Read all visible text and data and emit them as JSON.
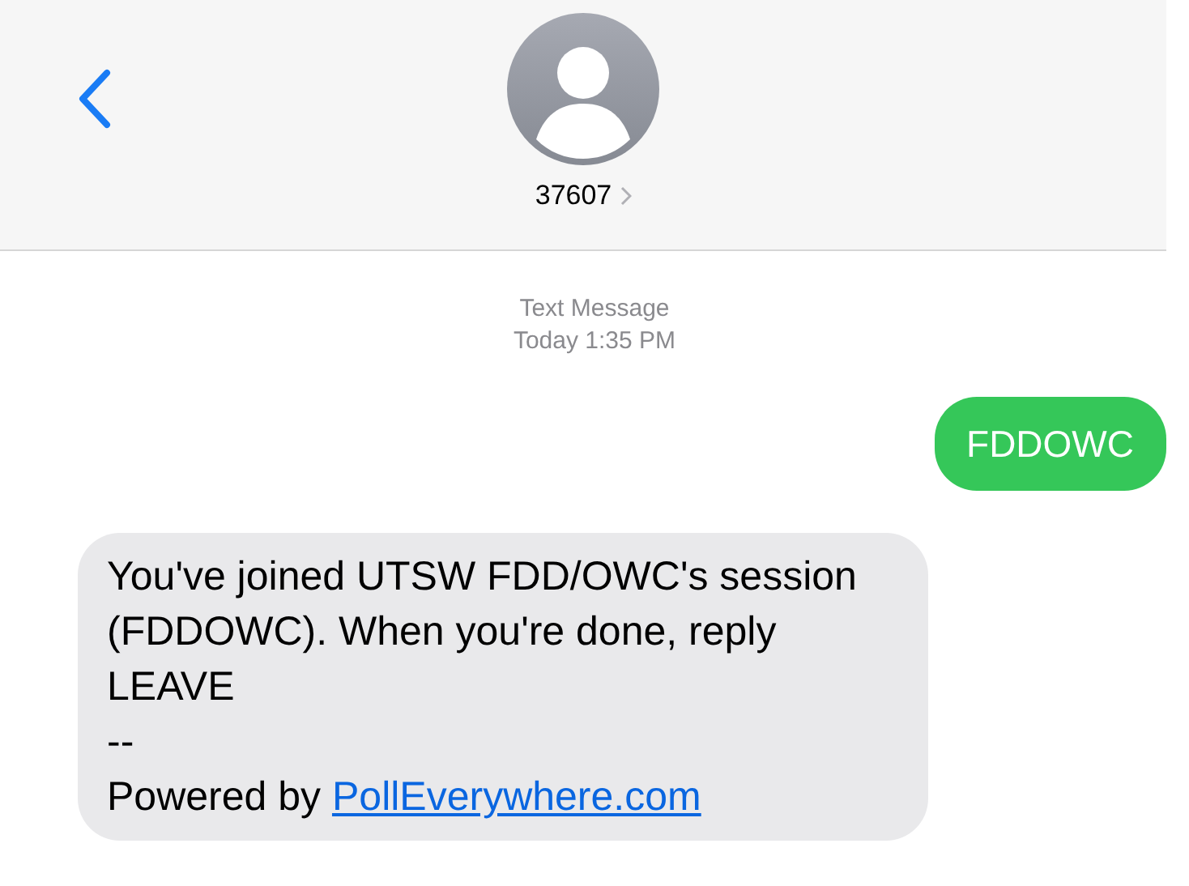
{
  "header": {
    "contact": "37607"
  },
  "timestamp": {
    "service": "Text Message",
    "time": "Today 1:35 PM"
  },
  "messages": [
    {
      "kind": "outgoing",
      "text": "FDDOWC"
    },
    {
      "kind": "incoming",
      "paragraphs": [
        "You've joined UTSW FDD/OWC's session (FDDOWC). When you're done, reply LEAVE",
        "--"
      ],
      "footer": {
        "text": "Powered by",
        "link": "PollEverywhere.com"
      }
    }
  ]
}
